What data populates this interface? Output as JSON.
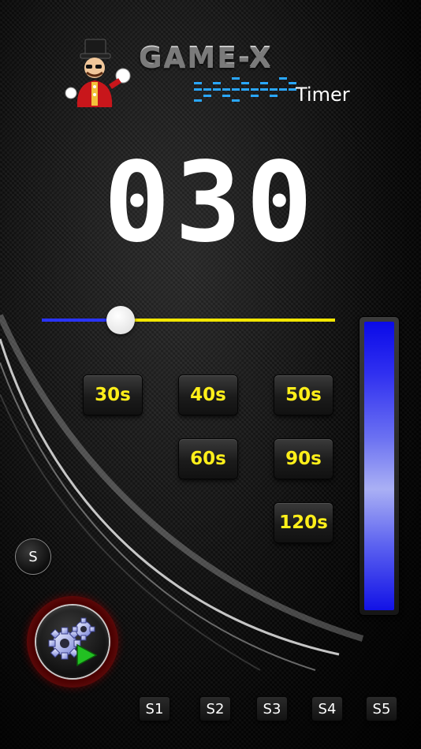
{
  "header": {
    "brand_title": "GAME-X",
    "brand_subtitle": "Timer"
  },
  "timer": {
    "display": "030"
  },
  "slider": {
    "value_fraction": 0.27,
    "colors": {
      "filled": "#2a34ff",
      "unfilled": "#f2e600",
      "thumb": "#ffffff"
    }
  },
  "presets": [
    "30s",
    "40s",
    "50s",
    "60s",
    "90s",
    "120s"
  ],
  "level_meter": {
    "fill_fraction": 1.0,
    "color": "#1a1ae8"
  },
  "s_button": {
    "label": "S"
  },
  "settings_button": {
    "icons": [
      "gear-icon",
      "play-icon"
    ]
  },
  "sounds": [
    "S1",
    "S2",
    "S3",
    "S4",
    "S5"
  ],
  "colors": {
    "preset_text": "#ffef1a",
    "accent_red": "#5c0a0a",
    "play_green": "#22c022",
    "eq_blue": "#2aa7ff"
  }
}
